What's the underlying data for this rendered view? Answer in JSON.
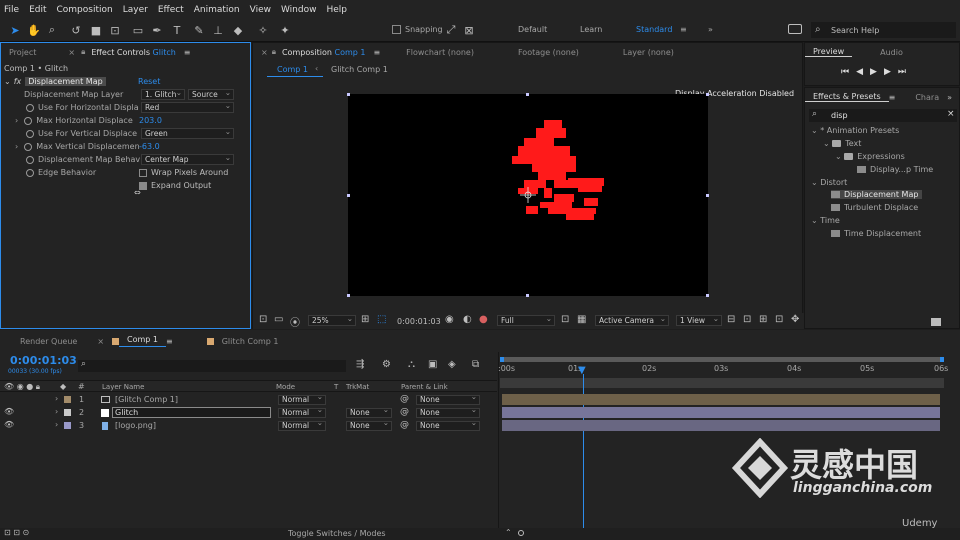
{
  "menu": [
    "File",
    "Edit",
    "Composition",
    "Layer",
    "Effect",
    "Animation",
    "View",
    "Window",
    "Help"
  ],
  "toolbar": {
    "snapping": "Snapping",
    "workspaces": [
      "Default",
      "Learn",
      "Standard"
    ],
    "active_workspace": "Standard",
    "search_help": "Search Help"
  },
  "left_panel": {
    "tab_project": "Project",
    "tab_effect_controls_prefix": "Effect Controls",
    "tab_effect_controls_layer": "Glitch",
    "breadcrumb": "Comp 1 • Glitch",
    "effect_name": "Displacement Map",
    "reset": "Reset",
    "props": [
      {
        "label": "Displacement Map Layer",
        "value": "1. Glitch",
        "value2": "Source"
      },
      {
        "label": "Use For Horizontal Displa",
        "value": "Red"
      },
      {
        "label": "Max Horizontal Displace",
        "value": "203.0"
      },
      {
        "label": "Use For Vertical Displace",
        "value": "Green"
      },
      {
        "label": "Max Vertical Displacemen",
        "value": "-63.0"
      },
      {
        "label": "Displacement Map Behav",
        "value": "Center Map"
      },
      {
        "label": "Edge Behavior",
        "value": "Wrap Pixels Around"
      },
      {
        "label": "",
        "value": "Expand Output"
      }
    ]
  },
  "comp_panel": {
    "tab_composition_prefix": "Composition",
    "tab_composition_name": "Comp 1",
    "tab_flowchart": "Flowchart (none)",
    "tab_footage": "Footage (none)",
    "tab_layer": "Layer (none)",
    "sub_tabs": [
      "Comp 1",
      "Glitch Comp 1"
    ],
    "accel_notice": "Display Acceleration Disabled",
    "bottom": {
      "zoom": "25%",
      "timecode": "0:00:01:03",
      "resolution": "Full",
      "camera": "Active Camera",
      "views": "1 View"
    }
  },
  "right_panel": {
    "tab_preview": "Preview",
    "tab_audio": "Audio",
    "tab_effects": "Effects & Presets",
    "tab_char": "Chara",
    "search_value": "disp",
    "tree": [
      {
        "label": "* Animation Presets",
        "type": "folder-open",
        "indent": 0
      },
      {
        "label": "Text",
        "type": "folder",
        "indent": 1
      },
      {
        "label": "Expressions",
        "type": "folder",
        "indent": 2
      },
      {
        "label": "Display...p Time",
        "type": "preset",
        "indent": 3
      },
      {
        "label": "Distort",
        "type": "category",
        "indent": 0
      },
      {
        "label": "Displacement Map",
        "type": "effect",
        "indent": 1,
        "selected": true
      },
      {
        "label": "Turbulent Displace",
        "type": "effect",
        "indent": 1
      },
      {
        "label": "Time",
        "type": "category",
        "indent": 0
      },
      {
        "label": "Time Displacement",
        "type": "effect",
        "indent": 1
      }
    ]
  },
  "timeline": {
    "tabs": [
      "Render Queue",
      "Comp 1",
      "Glitch Comp 1"
    ],
    "timecode": "0:00:01:03",
    "frame_info": "00033 (30.00 fps)",
    "columns": {
      "layer_name": "Layer Name",
      "mode": "Mode",
      "t": "T",
      "trkmat": "TrkMat",
      "parent": "Parent & Link",
      "hash": "#"
    },
    "ruler": [
      ":00s",
      "01s",
      "02s",
      "03s",
      "04s",
      "05s",
      "06s"
    ],
    "layers": [
      {
        "num": "1",
        "name": "[Glitch Comp 1]",
        "mode": "Normal",
        "trkmat": "",
        "parent": "None",
        "color": "#a38c6a"
      },
      {
        "num": "2",
        "name": "Glitch",
        "mode": "Normal",
        "trkmat": "None",
        "parent": "None",
        "color": "#c9c9c9"
      },
      {
        "num": "3",
        "name": "[logo.png]",
        "mode": "Normal",
        "trkmat": "None",
        "parent": "None",
        "color": "#9999c9"
      }
    ],
    "toggle_label": "Toggle Switches / Modes"
  },
  "watermark": {
    "brand_cn": "灵感中国",
    "brand_url": "lingganchina.com",
    "udemy": "Udemy"
  },
  "colors": {
    "accent": "#2d8ceb",
    "glitch_red": "#ff1a1a",
    "layer_bar_1": "#6e6049",
    "layer_bar_2": "#77759a",
    "layer_bar_3": "#696782"
  }
}
